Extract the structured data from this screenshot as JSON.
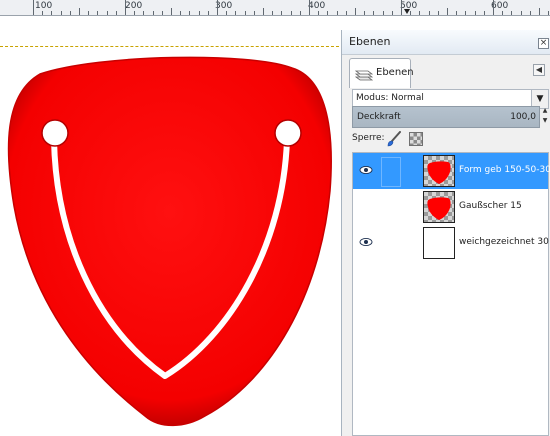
{
  "ruler": {
    "labels": [
      "100",
      "200",
      "300",
      "400",
      "500",
      "600"
    ]
  },
  "panel": {
    "title": "Ebenen",
    "tab_label": "Ebenen",
    "mode_label": "Modus: Normal",
    "opacity_label": "Deckkraft",
    "opacity_value": "100,0",
    "lock_label": "Sperre:"
  },
  "layers": [
    {
      "name": "Form geb 150-50-30",
      "visible": true,
      "selected": true,
      "thumbnail": "red-shield"
    },
    {
      "name": "Gaußscher 15",
      "visible": false,
      "selected": false,
      "thumbnail": "red-shield"
    },
    {
      "name": "weichgezeichnet 30",
      "visible": true,
      "selected": false,
      "thumbnail": "white"
    }
  ],
  "colors": {
    "shape": "#ff0000",
    "selection": "#3399ff",
    "guide": "#c9a300"
  }
}
